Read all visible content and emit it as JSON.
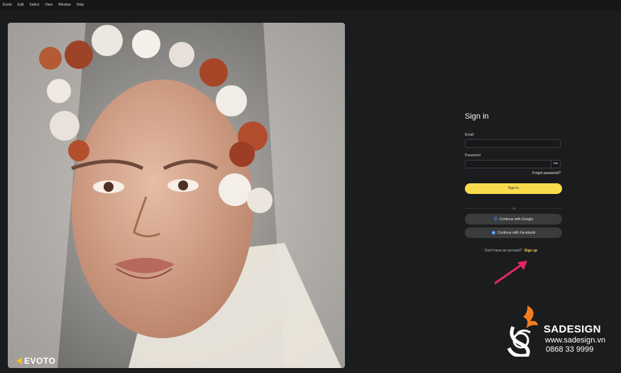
{
  "menubar": {
    "items": [
      "Evoto",
      "Edit",
      "Select",
      "View",
      "Window",
      "Help"
    ]
  },
  "photo": {
    "brand_text": "EVOTO",
    "brand_color": "#f2c318"
  },
  "signin": {
    "title": "Sign in",
    "email_label": "Email",
    "email_value": "",
    "password_label": "Password",
    "password_value": "",
    "forgot_label": "Forgot password?",
    "signin_button_label": "Sign in",
    "or_label": "OR",
    "google_label": "Continue with Google",
    "facebook_label": "Continue with Facebook",
    "no_account_text": "Don't have an account?",
    "signup_label": "Sign up",
    "accent_color": "#f8dc4c"
  },
  "watermark": {
    "name": "SADESIGN",
    "url": "www.sadesign.vn",
    "phone": "0868 33 9999"
  }
}
